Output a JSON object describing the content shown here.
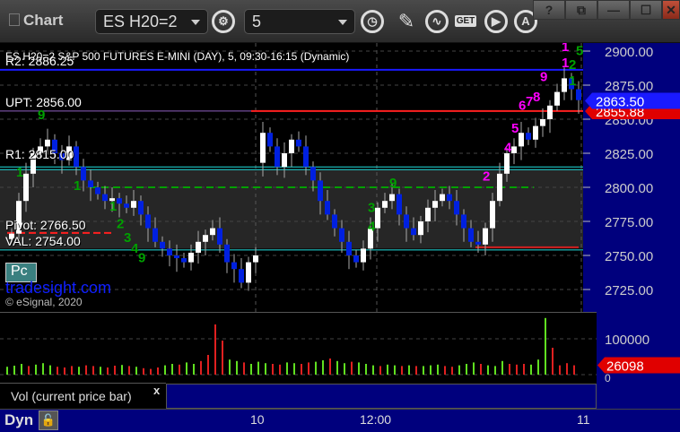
{
  "header": {
    "title": "Chart",
    "symbol": "ES H20=2",
    "interval": "5",
    "get_label": "GET",
    "help": "?"
  },
  "chart": {
    "description": "ES H20=2 S&P 500 FUTURES E-MINI (DAY), 5, 09:30-16:15 (Dynamic)",
    "levels": {
      "r2": "R2: 2886.25",
      "upt": "UPT: 2856.00",
      "r1": "R1: 2815.00",
      "pivot": "Pivot: 2766.50",
      "val": "VAL: 2754.00"
    },
    "watermark": "tradesight.com",
    "copyright": "© eSignal, 2020",
    "pc_label": "Pc",
    "last_price": "2863.50",
    "other_price": "2855.88",
    "colors": {
      "up": "#ffffff",
      "down": "#0020e0",
      "axis": "#00007d"
    }
  },
  "chart_data": {
    "type": "candlestick",
    "y_ticks": [
      "2900.00",
      "2875.00",
      "2850.00",
      "2825.00",
      "2800.00",
      "2775.00",
      "2750.00",
      "2725.00"
    ],
    "ylim": [
      2712,
      2905
    ],
    "x_ticks": [
      "10",
      "12:00",
      "11"
    ],
    "closes": [
      2766,
      2790,
      2810,
      2825,
      2830,
      2835,
      2825,
      2820,
      2830,
      2815,
      2805,
      2800,
      2795,
      2790,
      2792,
      2788,
      2785,
      2790,
      2780,
      2770,
      2760,
      2755,
      2750,
      2748,
      2745,
      2752,
      2760,
      2765,
      2770,
      2758,
      2745,
      2740,
      2730,
      2745,
      2750,
      2840,
      2830,
      2815,
      2825,
      2835,
      2830,
      2815,
      2805,
      2790,
      2780,
      2770,
      2760,
      2750,
      2745,
      2755,
      2770,
      2785,
      2790,
      2795,
      2780,
      2770,
      2765,
      2775,
      2785,
      2790,
      2795,
      2790,
      2780,
      2770,
      2760,
      2758,
      2770,
      2790,
      2810,
      2825,
      2830,
      2840,
      2835,
      2845,
      2850,
      2860,
      2870,
      2880,
      2872,
      2864
    ],
    "markers": [
      {
        "bar": 4,
        "price": 2850,
        "text": "9",
        "color": "#00a000"
      },
      {
        "bar": 1,
        "price": 2808,
        "text": "1",
        "color": "#00a000"
      },
      {
        "bar": 9,
        "price": 2798,
        "text": "1",
        "color": "#00a000"
      },
      {
        "bar": 14,
        "price": 2783,
        "text": "1",
        "color": "#00a000"
      },
      {
        "bar": 15,
        "price": 2770,
        "text": "2",
        "color": "#00a000"
      },
      {
        "bar": 16,
        "price": 2760,
        "text": "3",
        "color": "#00a000"
      },
      {
        "bar": 17,
        "price": 2752,
        "text": "4",
        "color": "#00a000"
      },
      {
        "bar": 18,
        "price": 2745,
        "text": "9",
        "color": "#00a000"
      },
      {
        "bar": 53,
        "price": 2800,
        "text": "9",
        "color": "#00a000"
      },
      {
        "bar": 50,
        "price": 2782,
        "text": "3",
        "color": "#00a000"
      },
      {
        "bar": 50,
        "price": 2768,
        "text": "4",
        "color": "#00a000"
      },
      {
        "bar": 66,
        "price": 2805,
        "text": "2",
        "color": "#ff00ff"
      },
      {
        "bar": 69,
        "price": 2826,
        "text": "4",
        "color": "#ff00ff"
      },
      {
        "bar": 70,
        "price": 2840,
        "text": "5",
        "color": "#ff00ff"
      },
      {
        "bar": 71,
        "price": 2857,
        "text": "6",
        "color": "#ff00ff"
      },
      {
        "bar": 72,
        "price": 2860,
        "text": "7",
        "color": "#ff00ff"
      },
      {
        "bar": 73,
        "price": 2863,
        "text": "8",
        "color": "#ff00ff"
      },
      {
        "bar": 74,
        "price": 2878,
        "text": "9",
        "color": "#ff00ff"
      },
      {
        "bar": 77,
        "price": 2888,
        "text": "1",
        "color": "#ff00ff"
      },
      {
        "bar": 77,
        "price": 2900,
        "text": "1",
        "color": "#ff00ff"
      },
      {
        "bar": 78,
        "price": 2887,
        "text": "2",
        "color": "#00a000"
      },
      {
        "bar": 78,
        "price": 2875,
        "text": "1",
        "color": "#00a000"
      },
      {
        "bar": 79,
        "price": 2897,
        "text": "5",
        "color": "#00a000"
      }
    ],
    "volume": {
      "ticks": [
        "100000",
        "0"
      ],
      "last": "26098",
      "values": [
        22000,
        25000,
        30000,
        24000,
        28000,
        32000,
        26000,
        22000,
        20000,
        24000,
        22000,
        26000,
        24000,
        22000,
        20000,
        25000,
        27000,
        24000,
        22000,
        18000,
        16000,
        20000,
        26000,
        30000,
        28000,
        34000,
        30000,
        38000,
        55000,
        140000,
        95000,
        42000,
        38000,
        34000,
        30000,
        36000,
        32000,
        30000,
        28000,
        34000,
        32000,
        30000,
        34000,
        36000,
        40000,
        45000,
        38000,
        32000,
        36000,
        34000,
        30000,
        26000,
        24000,
        28000,
        26000,
        24000,
        26000,
        24000,
        24000,
        26000,
        28000,
        24000,
        22000,
        26000,
        30000,
        34000,
        30000,
        26000,
        24000,
        38000,
        30000,
        28000,
        30000,
        28000,
        42000,
        158000,
        75000,
        26000,
        32000,
        26098
      ],
      "up": [
        1,
        1,
        1,
        0,
        1,
        1,
        1,
        0,
        0,
        0,
        1,
        0,
        0,
        1,
        0,
        0,
        1,
        0,
        1,
        0,
        0,
        0,
        1,
        1,
        0,
        1,
        1,
        0,
        0,
        0,
        0,
        1,
        1,
        0,
        1,
        1,
        1,
        0,
        0,
        1,
        1,
        0,
        0,
        1,
        1,
        0,
        1,
        1,
        0,
        1,
        1,
        1,
        0,
        1,
        1,
        0,
        1,
        0,
        1,
        1,
        1,
        0,
        0,
        1,
        1,
        1,
        0,
        1,
        1,
        1,
        0,
        0,
        0,
        1,
        1,
        1,
        0,
        0,
        0,
        0
      ]
    }
  },
  "volume_pane": {
    "label": "Vol (current price bar)",
    "close": "x"
  },
  "footer": {
    "mode": "Dyn"
  }
}
